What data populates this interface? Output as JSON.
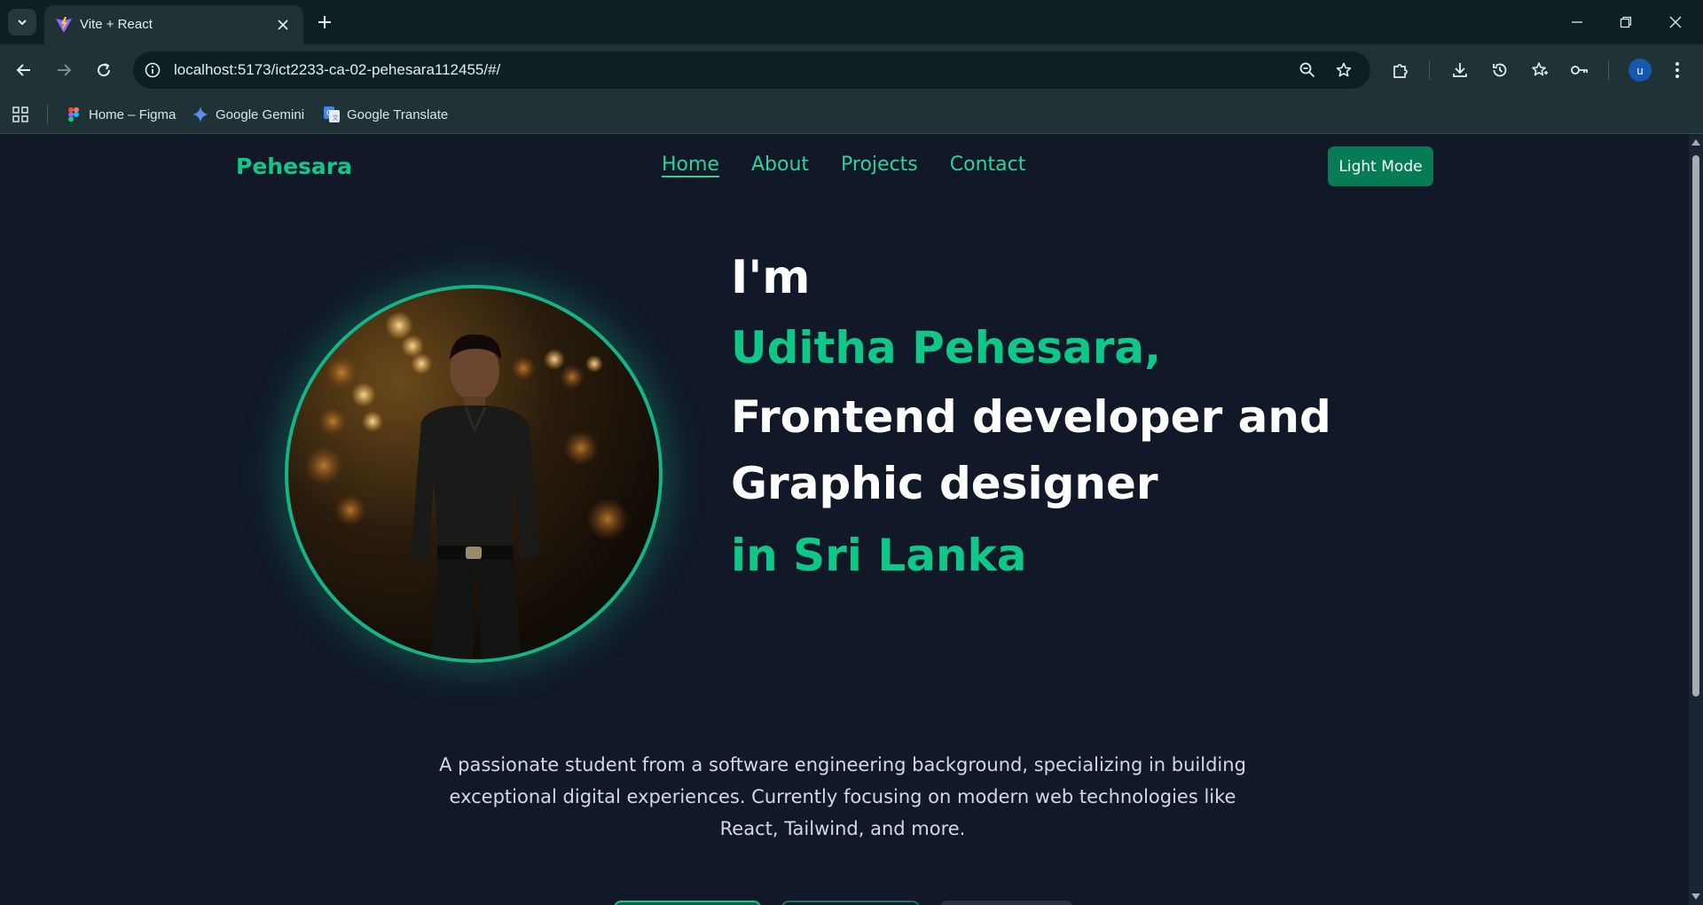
{
  "browser": {
    "tab_title": "Vite + React",
    "url": "localhost:5173/ict2233-ca-02-pehesara112455/#/",
    "profile_initial": "u",
    "bookmarks": [
      {
        "label": "Home – Figma",
        "icon": "figma-icon"
      },
      {
        "label": "Google Gemini",
        "icon": "gemini-icon"
      },
      {
        "label": "Google Translate",
        "icon": "translate-icon"
      }
    ]
  },
  "site": {
    "brand": "Pehesara",
    "nav": [
      "Home",
      "About",
      "Projects",
      "Contact"
    ],
    "active_nav": "Home",
    "mode_button": "Light Mode"
  },
  "hero": {
    "line1": "I'm",
    "name": "Uditha Pehesara,",
    "line3": "Frontend developer and",
    "line4": "Graphic designer",
    "line5": "in Sri Lanka",
    "intro_line1": "A passionate student from a software engineering background, specializing in building",
    "intro_line2": "exceptional digital experiences. Currently focusing on modern web technologies like",
    "intro_line3": "React, Tailwind, and more."
  },
  "colors": {
    "accent": "#10c78a",
    "page_bg": "#111827",
    "button_bg": "#077a56"
  }
}
